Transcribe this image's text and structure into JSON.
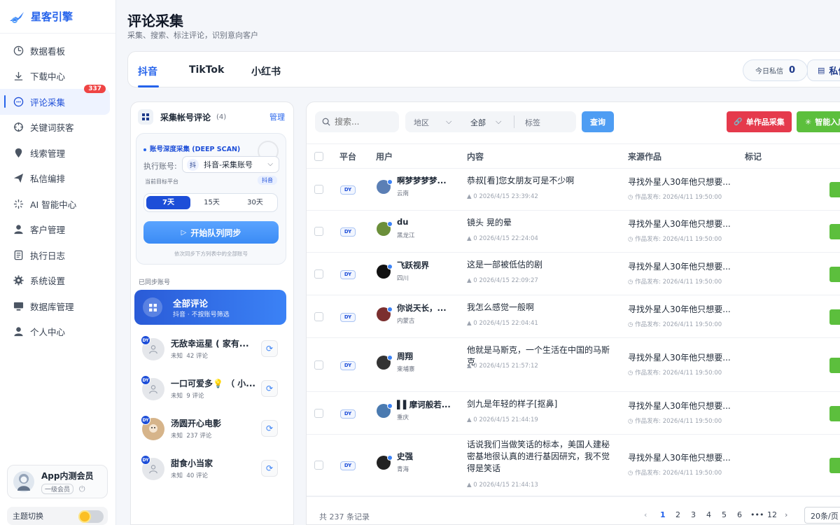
{
  "brand": {
    "name": "星客引擎"
  },
  "nav": [
    {
      "label": "数据看板",
      "icon": "dashboard-icon"
    },
    {
      "label": "下载中心",
      "icon": "download-icon"
    },
    {
      "label": "评论采集",
      "icon": "comment-icon",
      "badge": "337",
      "active": true
    },
    {
      "label": "关键词获客",
      "icon": "target-icon"
    },
    {
      "label": "线索管理",
      "icon": "lead-icon"
    },
    {
      "label": "私信编排",
      "icon": "send-icon"
    },
    {
      "label": "AI 智能中心",
      "icon": "sparkle-icon"
    },
    {
      "label": "客户管理",
      "icon": "user-icon"
    },
    {
      "label": "执行日志",
      "icon": "log-icon"
    },
    {
      "label": "系统设置",
      "icon": "gear-icon"
    },
    {
      "label": "数据库管理",
      "icon": "database-icon"
    },
    {
      "label": "个人中心",
      "icon": "person-icon"
    }
  ],
  "member": {
    "name": "App内测会员",
    "level": "一级会员"
  },
  "theme": {
    "label": "主题切换"
  },
  "page": {
    "title": "评论采集",
    "subtitle": "采集、搜索、标注评论，识别意向客户"
  },
  "platform_tabs": [
    "抖音",
    "TikTok",
    "小红书"
  ],
  "today": {
    "label": "今日私信",
    "value": "0"
  },
  "private_btn": "私信",
  "left": {
    "title": "采集帐号评论",
    "count": "(4)",
    "manage": "管理",
    "deep_title": "账号深度采集 (DEEP SCAN)",
    "exec_label": "执行账号:",
    "exec_account": "抖音-采集账号",
    "exec_icon_char": "抖",
    "target_label": "当前目标平台",
    "target_badge": "抖音",
    "ranges": [
      "7天",
      "15天",
      "30天"
    ],
    "sync_button": "开始队列同步",
    "sync_note": "依次同步下方列表中的全部账号",
    "synced_label": "已同步账号",
    "all_title": "全部评论",
    "all_sub": "抖音 · 不按账号筛选",
    "dy_tag": "DY",
    "accounts": [
      {
        "name": "无敌幸运星 ( 家有...",
        "status": "未知",
        "comments": "42 评论"
      },
      {
        "name": "一口可爱多💡 （ 小...",
        "status": "未知",
        "comments": "9 评论"
      },
      {
        "name": "汤圆开心电影",
        "status": "未知",
        "comments": "237 评论"
      },
      {
        "name": "甜食小当家",
        "status": "未知",
        "comments": "40 评论"
      }
    ]
  },
  "toolbar": {
    "search_placeholder": "搜索...",
    "region": "地区",
    "all": "全部",
    "tag": "标签",
    "query": "查询",
    "single": "单作品采集",
    "smart": "智能入库"
  },
  "table": {
    "headers": [
      "平台",
      "用户",
      "内容",
      "来源作品",
      "标记"
    ],
    "rows": [
      {
        "platform": "DY",
        "user": "啊梦梦梦梦...",
        "region": "云南",
        "content": "恭叔[看]您女朋友可是不少啊",
        "meta": "0 2026/4/15 23:39:42",
        "source": "寻找外星人30年他只想要...",
        "published": "作品发布: 2026/4/11 19:50:00"
      },
      {
        "platform": "DY",
        "user": "du",
        "region": "黑龙江",
        "content": "镜头 晃的晕",
        "meta": "0 2026/4/15 22:24:04",
        "source": "寻找外星人30年他只想要...",
        "published": "作品发布: 2026/4/11 19:50:00"
      },
      {
        "platform": "DY",
        "user": "飞跃视界",
        "region": "四川",
        "content": "这是一部被低估的剧",
        "meta": "0 2026/4/15 22:09:27",
        "source": "寻找外星人30年他只想要...",
        "published": "作品发布: 2026/4/11 19:50:00"
      },
      {
        "platform": "DY",
        "user": "你说天长，...",
        "region": "内蒙古",
        "content": "我怎么感觉一般啊",
        "meta": "0 2026/4/15 22:04:41",
        "source": "寻找外星人30年他只想要...",
        "published": "作品发布: 2026/4/11 19:50:00"
      },
      {
        "platform": "DY",
        "user": "周翔",
        "region": "柬埔寨",
        "content": "他就是马斯克，一个生活在中国的马斯克",
        "meta": "0 2026/4/15 21:57:12",
        "source": "寻找外星人30年他只想要...",
        "published": "作品发布: 2026/4/11 19:50:00"
      },
      {
        "platform": "DY",
        "user": "▌▌摩诃般若...",
        "region": "重庆",
        "content": "剑九是年轻的样子[抠鼻]",
        "meta": "0 2026/4/15 21:44:19",
        "source": "寻找外星人30年他只想要...",
        "published": "作品发布: 2026/4/11 19:50:00"
      },
      {
        "platform": "DY",
        "user": "史强",
        "region": "青海",
        "content": "话说我们当做笑话的标本，美国人建秘密基地很认真的进行基因研究，我不觉得是笑话",
        "meta": "0 2026/4/15 21:44:13",
        "source": "寻找外星人30年他只想要...",
        "published": "作品发布: 2026/4/11 19:50:00"
      }
    ]
  },
  "footer": {
    "total": "共 237 条记录",
    "pages": [
      "1",
      "2",
      "3",
      "4",
      "5",
      "6",
      "•••",
      "12"
    ],
    "page_size": "20条/页"
  },
  "colors": {
    "accent": "#2563eb",
    "danger": "#e53a4c",
    "success": "#5cbf3d"
  }
}
